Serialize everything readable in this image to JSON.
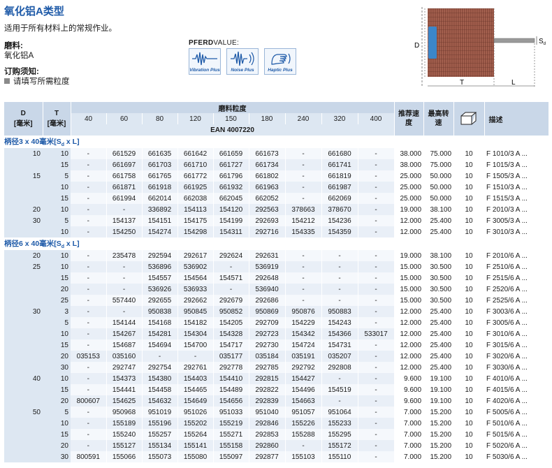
{
  "header": {
    "title": "氧化铝A类型",
    "subtitle": "适用于所有材料上的常规作业。",
    "abrasive_label": "磨料:",
    "abrasive_value": "氧化铝A",
    "order_label": "订购须知:",
    "order_note": "请填写所需粒度"
  },
  "pferdvalue": {
    "brand": "PFERD",
    "suffix": "VALUE:",
    "icons": [
      {
        "name": "vibration-icon",
        "caption": "Vibration Plus"
      },
      {
        "name": "noise-icon",
        "caption": "Noise Plus"
      },
      {
        "name": "haptic-icon",
        "caption": "Haptic Plus"
      }
    ]
  },
  "diagram": {
    "d": "D",
    "t": "T",
    "l": "L",
    "s": "S",
    "s_sub": "d"
  },
  "table": {
    "col_d": "D",
    "col_d_unit": "[毫米]",
    "col_t": "T",
    "col_t_unit": "[毫米]",
    "grit_header": "磨料粒度",
    "grits": [
      "40",
      "60",
      "80",
      "120",
      "150",
      "180",
      "240",
      "320",
      "400"
    ],
    "ean": "EAN 4007220",
    "col_speed": "推荐速度",
    "col_max": "最高转速",
    "col_pack_icon": "package-icon",
    "col_desc": "描述"
  },
  "sections": [
    {
      "title_pre": "柄径3 x 40毫米[S",
      "title_sub": "d",
      "title_post": " x L]",
      "rows": [
        {
          "d": "10",
          "t": "10",
          "codes": [
            "-",
            "661529",
            "661635",
            "661642",
            "661659",
            "661673",
            "-",
            "661680",
            "-"
          ],
          "speed": "38.000",
          "max": "75.000",
          "pack": "10",
          "desc": "F 1010/3 A ..."
        },
        {
          "d": "",
          "t": "15",
          "codes": [
            "-",
            "661697",
            "661703",
            "661710",
            "661727",
            "661734",
            "-",
            "661741",
            "-"
          ],
          "speed": "38.000",
          "max": "75.000",
          "pack": "10",
          "desc": "F 1015/3 A ..."
        },
        {
          "d": "15",
          "t": "5",
          "codes": [
            "-",
            "661758",
            "661765",
            "661772",
            "661796",
            "661802",
            "-",
            "661819",
            "-"
          ],
          "speed": "25.000",
          "max": "50.000",
          "pack": "10",
          "desc": "F 1505/3 A ..."
        },
        {
          "d": "",
          "t": "10",
          "codes": [
            "-",
            "661871",
            "661918",
            "661925",
            "661932",
            "661963",
            "-",
            "661987",
            "-"
          ],
          "speed": "25.000",
          "max": "50.000",
          "pack": "10",
          "desc": "F 1510/3 A ..."
        },
        {
          "d": "",
          "t": "15",
          "codes": [
            "-",
            "661994",
            "662014",
            "662038",
            "662045",
            "662052",
            "-",
            "662069",
            "-"
          ],
          "speed": "25.000",
          "max": "50.000",
          "pack": "10",
          "desc": "F 1515/3 A ..."
        },
        {
          "d": "20",
          "t": "10",
          "codes": [
            "-",
            "-",
            "336892",
            "154113",
            "154120",
            "292563",
            "378663",
            "378670",
            "-"
          ],
          "speed": "19.000",
          "max": "38.100",
          "pack": "10",
          "desc": "F 2010/3 A ..."
        },
        {
          "d": "30",
          "t": "5",
          "codes": [
            "-",
            "154137",
            "154151",
            "154175",
            "154199",
            "292693",
            "154212",
            "154236",
            "-"
          ],
          "speed": "12.000",
          "max": "25.400",
          "pack": "10",
          "desc": "F 3005/3 A ..."
        },
        {
          "d": "",
          "t": "10",
          "codes": [
            "-",
            "154250",
            "154274",
            "154298",
            "154311",
            "292716",
            "154335",
            "154359",
            "-"
          ],
          "speed": "12.000",
          "max": "25.400",
          "pack": "10",
          "desc": "F 3010/3 A ..."
        }
      ]
    },
    {
      "title_pre": "柄径6 x 40毫米[S",
      "title_sub": "d",
      "title_post": " x L]",
      "rows": [
        {
          "d": "20",
          "t": "10",
          "codes": [
            "-",
            "235478",
            "292594",
            "292617",
            "292624",
            "292631",
            "-",
            "-",
            "-"
          ],
          "speed": "19.000",
          "max": "38.100",
          "pack": "10",
          "desc": "F 2010/6 A ..."
        },
        {
          "d": "25",
          "t": "10",
          "codes": [
            "-",
            "-",
            "536896",
            "536902",
            "-",
            "536919",
            "-",
            "-",
            "-"
          ],
          "speed": "15.000",
          "max": "30.500",
          "pack": "10",
          "desc": "F 2510/6 A ..."
        },
        {
          "d": "",
          "t": "15",
          "codes": [
            "-",
            "-",
            "154557",
            "154564",
            "154571",
            "292648",
            "-",
            "-",
            "-"
          ],
          "speed": "15.000",
          "max": "30.500",
          "pack": "10",
          "desc": "F 2515/6 A ..."
        },
        {
          "d": "",
          "t": "20",
          "codes": [
            "-",
            "-",
            "536926",
            "536933",
            "-",
            "536940",
            "-",
            "-",
            "-"
          ],
          "speed": "15.000",
          "max": "30.500",
          "pack": "10",
          "desc": "F 2520/6 A ..."
        },
        {
          "d": "",
          "t": "25",
          "codes": [
            "-",
            "557440",
            "292655",
            "292662",
            "292679",
            "292686",
            "-",
            "-",
            "-"
          ],
          "speed": "15.000",
          "max": "30.500",
          "pack": "10",
          "desc": "F 2525/6 A ..."
        },
        {
          "d": "30",
          "t": "3",
          "codes": [
            "-",
            "-",
            "950838",
            "950845",
            "950852",
            "950869",
            "950876",
            "950883",
            "-"
          ],
          "speed": "12.000",
          "max": "25.400",
          "pack": "10",
          "desc": "F 3003/6 A ..."
        },
        {
          "d": "",
          "t": "5",
          "codes": [
            "-",
            "154144",
            "154168",
            "154182",
            "154205",
            "292709",
            "154229",
            "154243",
            "-"
          ],
          "speed": "12.000",
          "max": "25.400",
          "pack": "10",
          "desc": "F 3005/6 A ..."
        },
        {
          "d": "",
          "t": "10",
          "codes": [
            "-",
            "154267",
            "154281",
            "154304",
            "154328",
            "292723",
            "154342",
            "154366",
            "533017"
          ],
          "speed": "12.000",
          "max": "25.400",
          "pack": "10",
          "desc": "F 3010/6 A ..."
        },
        {
          "d": "",
          "t": "15",
          "codes": [
            "-",
            "154687",
            "154694",
            "154700",
            "154717",
            "292730",
            "154724",
            "154731",
            "-"
          ],
          "speed": "12.000",
          "max": "25.400",
          "pack": "10",
          "desc": "F 3015/6 A ..."
        },
        {
          "d": "",
          "t": "20",
          "codes": [
            "035153",
            "035160",
            "-",
            "-",
            "035177",
            "035184",
            "035191",
            "035207",
            "-"
          ],
          "speed": "12.000",
          "max": "25.400",
          "pack": "10",
          "desc": "F 3020/6 A ..."
        },
        {
          "d": "",
          "t": "30",
          "codes": [
            "-",
            "292747",
            "292754",
            "292761",
            "292778",
            "292785",
            "292792",
            "292808",
            "-"
          ],
          "speed": "12.000",
          "max": "25.400",
          "pack": "10",
          "desc": "F 3030/6 A ..."
        },
        {
          "d": "40",
          "t": "10",
          "codes": [
            "-",
            "154373",
            "154380",
            "154403",
            "154410",
            "292815",
            "154427",
            "-",
            "-"
          ],
          "speed": "9.600",
          "max": "19.100",
          "pack": "10",
          "desc": "F 4010/6 A ..."
        },
        {
          "d": "",
          "t": "15",
          "codes": [
            "-",
            "154441",
            "154458",
            "154465",
            "154489",
            "292822",
            "154496",
            "154519",
            "-"
          ],
          "speed": "9.600",
          "max": "19.100",
          "pack": "10",
          "desc": "F 4015/6 A ..."
        },
        {
          "d": "",
          "t": "20",
          "codes": [
            "800607",
            "154625",
            "154632",
            "154649",
            "154656",
            "292839",
            "154663",
            "-",
            "-"
          ],
          "speed": "9.600",
          "max": "19.100",
          "pack": "10",
          "desc": "F 4020/6 A ..."
        },
        {
          "d": "50",
          "t": "5",
          "codes": [
            "-",
            "950968",
            "951019",
            "951026",
            "951033",
            "951040",
            "951057",
            "951064",
            "-"
          ],
          "speed": "7.000",
          "max": "15.200",
          "pack": "10",
          "desc": "F 5005/6 A ..."
        },
        {
          "d": "",
          "t": "10",
          "codes": [
            "-",
            "155189",
            "155196",
            "155202",
            "155219",
            "292846",
            "155226",
            "155233",
            "-"
          ],
          "speed": "7.000",
          "max": "15.200",
          "pack": "10",
          "desc": "F 5010/6 A ..."
        },
        {
          "d": "",
          "t": "15",
          "codes": [
            "-",
            "155240",
            "155257",
            "155264",
            "155271",
            "292853",
            "155288",
            "155295",
            "-"
          ],
          "speed": "7.000",
          "max": "15.200",
          "pack": "10",
          "desc": "F 5015/6 A ..."
        },
        {
          "d": "",
          "t": "20",
          "codes": [
            "-",
            "155127",
            "155134",
            "155141",
            "155158",
            "292860",
            "-",
            "155172",
            "-"
          ],
          "speed": "7.000",
          "max": "15.200",
          "pack": "10",
          "desc": "F 5020/6 A ..."
        },
        {
          "d": "",
          "t": "30",
          "codes": [
            "800591",
            "155066",
            "155073",
            "155080",
            "155097",
            "292877",
            "155103",
            "155110",
            "-"
          ],
          "speed": "7.000",
          "max": "15.200",
          "pack": "10",
          "desc": "F 5030/6 A ..."
        }
      ]
    }
  ]
}
